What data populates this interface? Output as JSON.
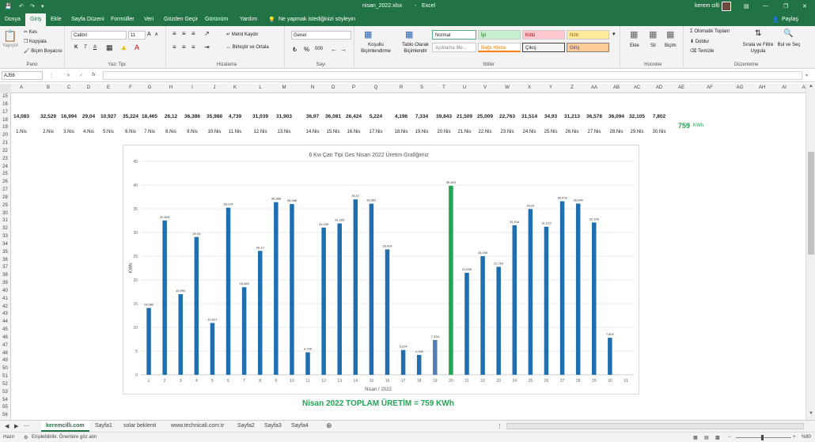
{
  "titlebar": {
    "file": "nisan_2022.xlsx",
    "separator": "-",
    "app": "Excel",
    "user": "kerem cilli"
  },
  "tabs": [
    "Dosya",
    "Giriş",
    "Ekle",
    "Sayfa Düzeni",
    "Formüller",
    "Veri",
    "Gözden Geçir",
    "Görünüm",
    "Yardım"
  ],
  "tell_me": "Ne yapmak istediğinizi söyleyin",
  "share": "Paylaş",
  "ribbon": {
    "clipboard": {
      "paste": "Yapıştır",
      "cut": "Kes",
      "copy": "Kopyala",
      "format_painter": "Biçim Boyacısı",
      "group": "Pano"
    },
    "font": {
      "name": "Calibri",
      "size": "11",
      "bold": "K",
      "italic": "T",
      "underline": "A",
      "grow": "A",
      "shrink": "A",
      "group": "Yazı Tipi"
    },
    "alignment": {
      "wrap": "Metni Kaydır",
      "merge": "Birleştir ve Ortala",
      "group": "Hizalama"
    },
    "number": {
      "format": "Genel",
      "percent": "%",
      "comma": "000",
      "group": "Sayı"
    },
    "styles": {
      "conditional": "Koşullu Biçimlendirme",
      "table": "Tablo Olarak Biçimlendir",
      "normal": "Normal",
      "good": "İyi",
      "bad": "Kötü",
      "neutral": "Nötr",
      "explanatory": "Açıklama Me...",
      "linked": "Bağlı Hücre",
      "output": "Çıkış",
      "input": "Giriş",
      "group": "Stiller"
    },
    "cells": {
      "insert": "Ekle",
      "delete": "Sil",
      "format": "Biçim",
      "group": "Hücreler"
    },
    "editing": {
      "autosum": "Otomatik Toplam",
      "fill": "Doldur",
      "clear": "Temizle",
      "sort": "Sırala ve Filtre Uygula",
      "find": "Bul ve Seç",
      "group": "Düzenleme"
    }
  },
  "namebox": "AJ56",
  "fx": "fx",
  "columns": [
    "A",
    "B",
    "C",
    "D",
    "E",
    "F",
    "G",
    "H",
    "I",
    "J",
    "K",
    "L",
    "M",
    "N",
    "O",
    "P",
    "Q",
    "R",
    "S",
    "T",
    "U",
    "V",
    "W",
    "X",
    "Y",
    "Z",
    "AA",
    "AB",
    "AC",
    "AD",
    "AE",
    "AF",
    "AG",
    "AH",
    "AI",
    "AJ"
  ],
  "rows": [
    "15",
    "16",
    "17",
    "18",
    "19",
    "20",
    "21",
    "22",
    "23",
    "24",
    "25",
    "26",
    "27",
    "28",
    "29",
    "30",
    "31",
    "32",
    "33",
    "34",
    "35",
    "36",
    "37",
    "38",
    "39",
    "40",
    "41",
    "42",
    "43",
    "44",
    "45",
    "46",
    "47",
    "48",
    "49",
    "50",
    "51",
    "52",
    "53",
    "54",
    "55",
    "56"
  ],
  "values_row": [
    "14,083",
    "32,529",
    "16,994",
    "29,04",
    "10,927",
    "35,224",
    "18,465",
    "26,12",
    "36,386",
    "35,988",
    "4,739",
    "31,039",
    "31,903",
    "36,97",
    "36,081",
    "26,424",
    "5,224",
    "4,196",
    "7,334",
    "39,843",
    "21,509",
    "25,009",
    "22,763",
    "31,514",
    "34,93",
    "31,213",
    "36,578",
    "36,094",
    "32,105",
    "7,802"
  ],
  "dates_row": [
    "1.Nis",
    "2.Nis",
    "3.Nis",
    "4.Nis",
    "5.Nis",
    "6.Nis",
    "7.Nis",
    "8.Nis",
    "9.Nis",
    "10.Nis",
    "11.Nis",
    "12.Nis",
    "13.Nis",
    "14.Nis",
    "15.Nis",
    "16.Nis",
    "17.Nis",
    "18.Nis",
    "19.Nis",
    "20.Nis",
    "21.Nis",
    "22.Nis",
    "23.Nis",
    "24.Nis",
    "25.Nis",
    "26.Nis",
    "27.Nis",
    "28.Nis",
    "29.Nis",
    "30.Nis"
  ],
  "total": {
    "value": "759",
    "unit": "KWh"
  },
  "summary_text": "Nisan 2022 TOPLAM ÜRETİM = 759 KWh",
  "sheet_tabs": [
    "keremcilli.com",
    "Sayfa1",
    "solar beklenti",
    "www.technicali.com.tr",
    "Sayfa2",
    "Sayfa3",
    "Sayfa4"
  ],
  "status": {
    "ready": "Hazır",
    "accessibility": "Erişilebilirlik: Önerilere göz atın",
    "zoom": "%80"
  },
  "colors": {
    "excel_green": "#217346",
    "bar_blue": "#1f6fb0",
    "bar_highlight": "#22a552",
    "bar_dim": "#4f7fb6"
  },
  "chart_data": {
    "type": "bar",
    "title": "6 Kw Çatı Tipi Ges Nisan 2022 Üretim Grafiğimiz",
    "xlabel": "Nisan / 2022",
    "ylabel": "KWh",
    "ylim": [
      0,
      45
    ],
    "yticks": [
      0,
      5,
      10,
      15,
      20,
      25,
      30,
      35,
      40,
      45
    ],
    "categories": [
      "1",
      "2",
      "3",
      "4",
      "5",
      "6",
      "7",
      "8",
      "9",
      "10",
      "11",
      "12",
      "13",
      "14",
      "15",
      "16",
      "17",
      "18",
      "19",
      "20",
      "21",
      "22",
      "23",
      "24",
      "25",
      "26",
      "27",
      "28",
      "29",
      "30",
      "31"
    ],
    "values": [
      14.083,
      32.529,
      16.994,
      29.04,
      10.927,
      35.224,
      18.465,
      26.12,
      36.386,
      35.988,
      4.739,
      31.039,
      31.903,
      36.97,
      36.081,
      26.424,
      5.224,
      4.196,
      7.334,
      39.843,
      21.509,
      25.009,
      22.763,
      31.514,
      34.93,
      31.213,
      36.578,
      36.094,
      32.105,
      7.802,
      null
    ],
    "labels": [
      "14,083",
      "32,529",
      "16,994",
      "29,04",
      "10,927",
      "35,224",
      "18,465",
      "26,12",
      "36,386",
      "35,988",
      "4,739",
      "31,039",
      "31,903",
      "36,97",
      "36,081",
      "26,424",
      "5,224",
      "4,196",
      "7,334",
      "39,843",
      "21,509",
      "25,009",
      "22,763",
      "31,514",
      "34,93",
      "31,213",
      "36,578",
      "36,094",
      "32,105",
      "7,802",
      ""
    ],
    "highlight_index": 19,
    "dim_index": 18,
    "grid": true,
    "legend": "none"
  }
}
